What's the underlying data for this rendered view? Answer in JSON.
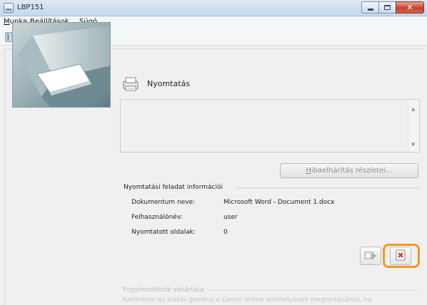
{
  "window": {
    "title": "LBP151",
    "controls": [
      "minimize-icon",
      "maximize-icon",
      "close-icon"
    ]
  },
  "menu": {
    "items": [
      {
        "underlined": "M",
        "rest": "unka"
      },
      {
        "underlined": "B",
        "rest": "eállítások"
      },
      {
        "underlined": "S",
        "rest": "úgó"
      }
    ]
  },
  "toolbar": {
    "icons": [
      "status-panel-icon",
      "refresh-icon",
      "printer-info-icon",
      "network-icon",
      "globe-icon"
    ]
  },
  "status": {
    "title": "Nyomtatás",
    "message": ""
  },
  "troubleshoot_button": {
    "underlined": "H",
    "rest": "ibaelhárítás részletei..."
  },
  "job_info": {
    "heading": "Nyomtatási feladat információi",
    "rows": [
      {
        "label": "Dokumentum neve:",
        "value": "Microsoft Word - Document 1.docx"
      },
      {
        "label": "Felhasználónév:",
        "value": "user"
      },
      {
        "label": "Nyomtatott oldalak:",
        "value": "0"
      }
    ]
  },
  "actions": {
    "icons": [
      "resume-job-icon",
      "cancel-job-icon"
    ],
    "highlight_color": "#f39a1e"
  },
  "consumables": {
    "heading": "Fogyóeszközök vásárlása",
    "text": "Kattintson az alábbi gombra a Canon online webhelyének megnyitásához, ha"
  },
  "colors": {
    "titlebar": "#c6d9ee",
    "window_bg": "#f0f0f0",
    "cancel_icon": "#d23a2a"
  }
}
